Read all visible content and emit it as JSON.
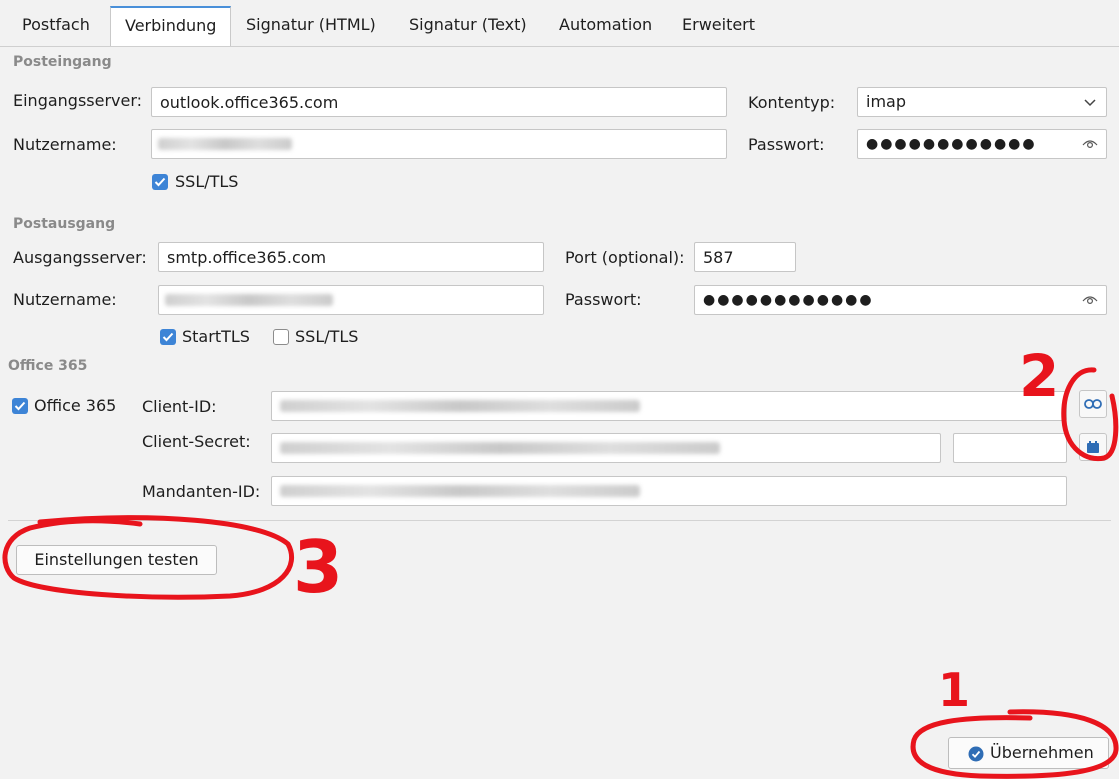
{
  "tabs": [
    {
      "label": "Postfach",
      "active": false
    },
    {
      "label": "Verbindung",
      "active": true
    },
    {
      "label": "Signatur (HTML)",
      "active": false
    },
    {
      "label": "Signatur (Text)",
      "active": false
    },
    {
      "label": "Automation",
      "active": false
    },
    {
      "label": "Erweitert",
      "active": false
    }
  ],
  "incoming": {
    "section_title": "Posteingang",
    "server_label": "Eingangsserver:",
    "server_value": "outlook.office365.com",
    "account_type_label": "Kontentyp:",
    "account_type_value": "imap",
    "username_label": "Nutzername:",
    "password_label": "Passwort:",
    "password_mask": "●●●●●●●●●●●●",
    "ssl_label": "SSL/TLS",
    "ssl_checked": true
  },
  "outgoing": {
    "section_title": "Postausgang",
    "server_label": "Ausgangsserver:",
    "server_value": "smtp.office365.com",
    "port_label": "Port (optional):",
    "port_value": "587",
    "username_label": "Nutzername:",
    "password_label": "Passwort:",
    "password_mask": "●●●●●●●●●●●●",
    "starttls_label": "StartTLS",
    "starttls_checked": true,
    "ssl_label": "SSL/TLS",
    "ssl_checked": false
  },
  "office365": {
    "section_title": "Office 365",
    "enable_label": "Office 365",
    "enable_checked": true,
    "client_id_label": "Client-ID:",
    "client_secret_label": "Client-Secret:",
    "tenant_id_label": "Mandanten-ID:"
  },
  "actions": {
    "test_label": "Einstellungen testen",
    "apply_label": "Übernehmen"
  },
  "annotations": {
    "mark_1": "1",
    "mark_2": "2",
    "mark_3": "3",
    "ink_color": "#e8141c"
  },
  "colors": {
    "accent": "#3d84d6",
    "background": "#f2f2f2"
  }
}
